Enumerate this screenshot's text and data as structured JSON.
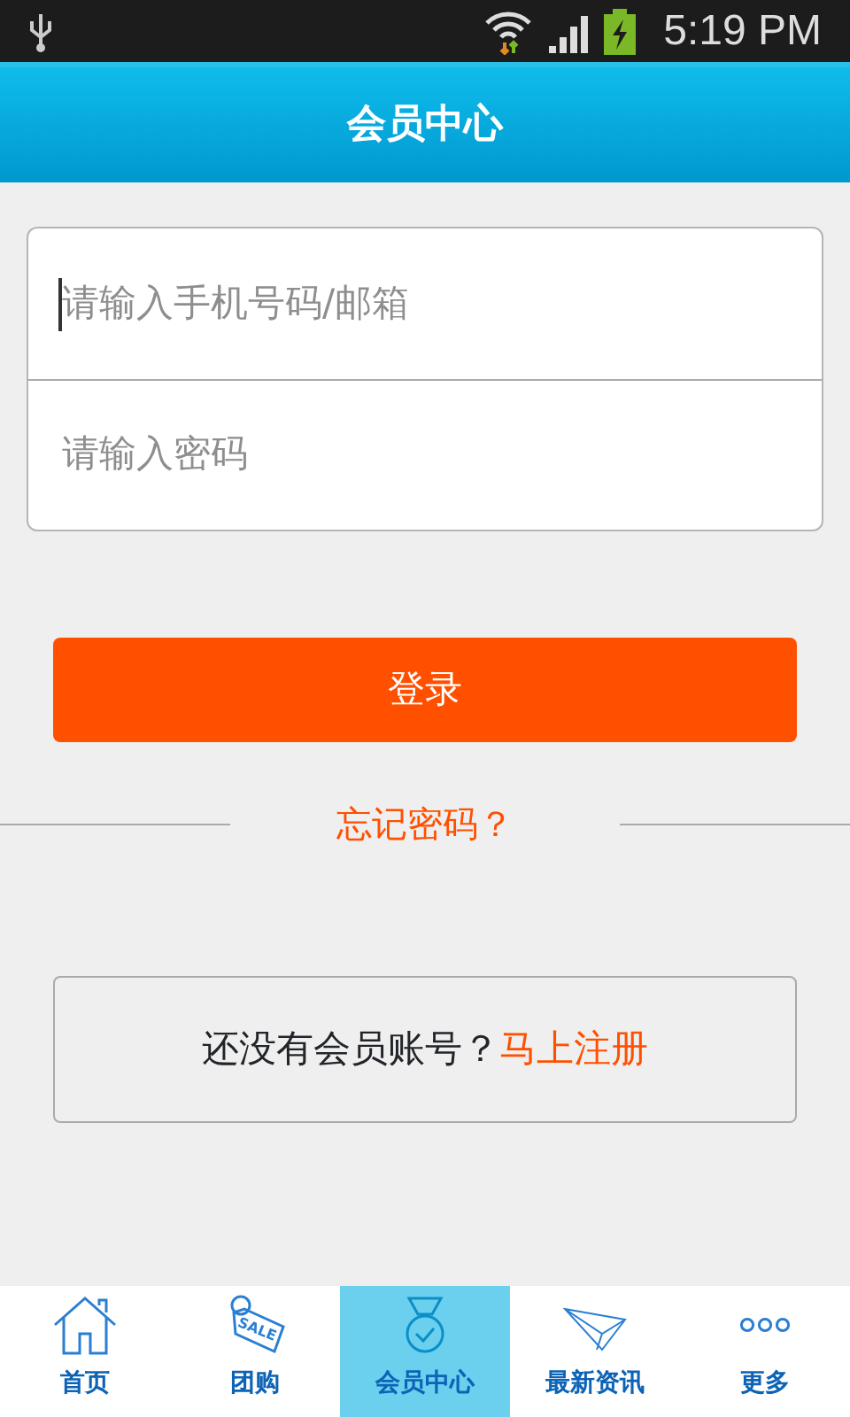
{
  "status_bar": {
    "time": "5:19 PM"
  },
  "header": {
    "title": "会员中心"
  },
  "fields": [
    {
      "placeholder": "请输入手机号码/邮箱",
      "focused": true
    },
    {
      "placeholder": "请输入密码",
      "focused": false
    }
  ],
  "login_button": "登录",
  "forgot_link": "忘记密码？",
  "register": {
    "text": "还没有会员账号？",
    "link": "马上注册"
  },
  "tabs": [
    {
      "label": "首页",
      "selected": false
    },
    {
      "label": "团购",
      "icon_text": "SALE",
      "selected": false
    },
    {
      "label": "会员中心",
      "selected": true
    },
    {
      "label": "最新资讯",
      "selected": false
    },
    {
      "label": "更多",
      "selected": false
    }
  ]
}
